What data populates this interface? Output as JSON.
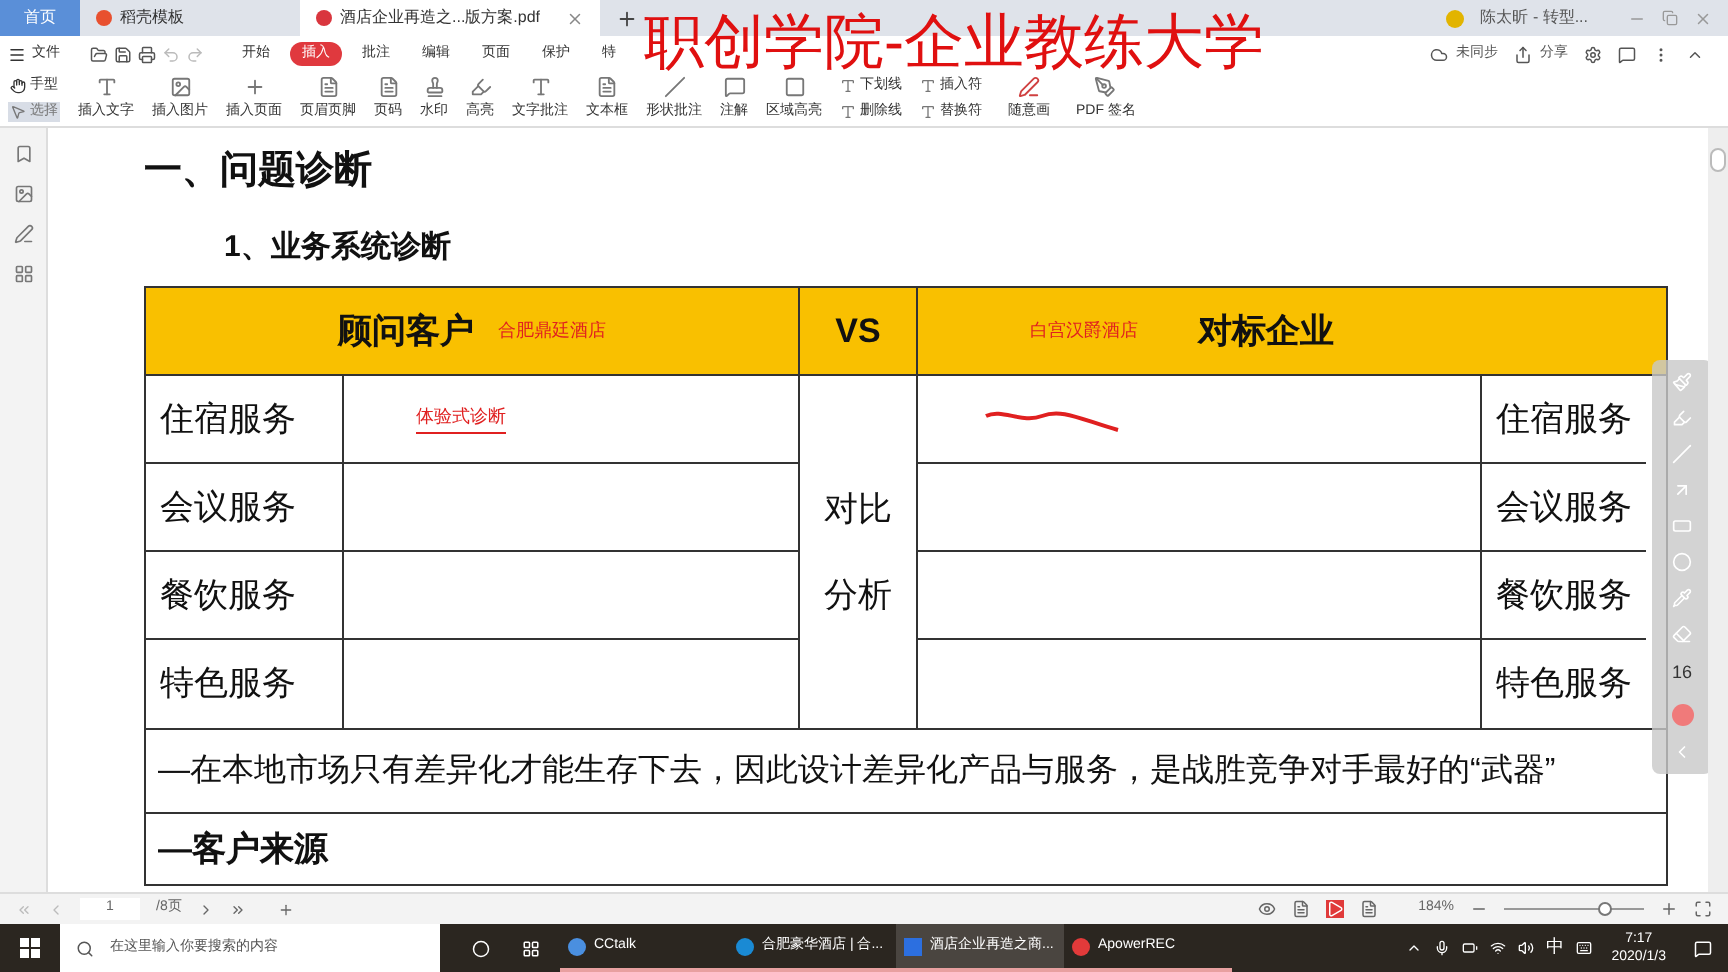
{
  "tabs": [
    {
      "label": "首页",
      "kind": "home",
      "selected": false
    },
    {
      "label": "稻壳模板",
      "kind": "app",
      "selected": false
    },
    {
      "label": "酒店企业再造之...版方案.pdf",
      "kind": "doc",
      "selected": true
    }
  ],
  "account": {
    "name": "陈太昕 - 转型..."
  },
  "menu": {
    "file": "文件",
    "items": [
      {
        "label": "开始",
        "selected": false
      },
      {
        "label": "插入",
        "selected": true
      },
      {
        "label": "批注",
        "selected": false
      },
      {
        "label": "编辑",
        "selected": false
      },
      {
        "label": "页面",
        "selected": false
      },
      {
        "label": "保护",
        "selected": false
      },
      {
        "label": "特",
        "selected": false
      }
    ],
    "right": [
      "未同步",
      "分享"
    ]
  },
  "overlay_title": "职创学院-企业教练大学",
  "tools": {
    "modes": [
      {
        "label": "手型",
        "selected": false
      },
      {
        "label": "选择",
        "selected": true
      }
    ],
    "big": [
      "插入文字",
      "插入图片",
      "插入页面",
      "页眉页脚",
      "页码",
      "水印",
      "高亮",
      "文字批注",
      "文本框",
      "形状批注",
      "注解",
      "区域高亮"
    ],
    "small": [
      [
        "下划线",
        "删除线"
      ],
      [
        "插入符",
        "替换符"
      ]
    ],
    "more": [
      "随意画",
      "PDF 签名"
    ]
  },
  "document": {
    "heading": "一、问题诊断",
    "subheading": "1、业务系统诊断",
    "table": {
      "left_header": "顾问客户",
      "left_note": "合肥鼎廷酒店",
      "vs": "VS",
      "right_note": "白宫汉爵酒店",
      "right_header": "对标企业",
      "rows": [
        {
          "left": "住宿服务",
          "right": "住宿服务"
        },
        {
          "left": "会议服务",
          "right": "会议服务"
        },
        {
          "left": "餐饮服务",
          "right": "餐饮服务"
        },
        {
          "left": "特色服务",
          "right": "特色服务"
        }
      ],
      "middle": [
        "对比",
        "分析"
      ],
      "stamp": "体验式诊断",
      "statement": "—在本地市场只有差异化才能生存下去，因此设计差异化产品与服务，是战胜竞争对手最好的“武器”",
      "section": "—客户来源"
    }
  },
  "pen_toolbar": {
    "size": "16"
  },
  "status": {
    "page": "1",
    "total": "/8页",
    "zoom": "184%",
    "zoom_slider": {
      "level": 0.72
    }
  },
  "taskbar": {
    "search_placeholder": "在这里输入你要搜索的内容",
    "apps": [
      {
        "label": "CCtalk",
        "kind": "cctalk",
        "selected": false
      },
      {
        "label": "合肥豪华酒店 | 合...",
        "kind": "browser",
        "selected": false
      },
      {
        "label": "酒店企业再造之商...",
        "kind": "wps",
        "selected": true
      },
      {
        "label": "ApowerREC",
        "kind": "rec",
        "selected": false
      }
    ],
    "ime": "中",
    "time": "7:17",
    "date": "2020/1/3"
  }
}
